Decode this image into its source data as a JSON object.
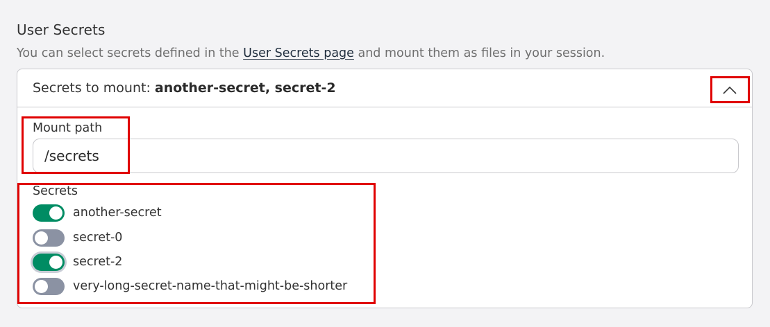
{
  "section": {
    "title": "User Secrets",
    "description_before": "You can select secrets defined in the ",
    "description_link": "User Secrets page",
    "description_after": " and mount them as files in your session."
  },
  "card": {
    "header_prefix": "Secrets to mount: ",
    "header_selected": "another-secret, secret-2",
    "collapse_icon": "chevron-up-icon"
  },
  "mount_path": {
    "label": "Mount path",
    "value": "/secrets"
  },
  "secrets": {
    "label": "Secrets",
    "items": [
      {
        "name": "another-secret",
        "enabled": true
      },
      {
        "name": "secret-0",
        "enabled": false
      },
      {
        "name": "secret-2",
        "enabled": true
      },
      {
        "name": "very-long-secret-name-that-might-be-shorter",
        "enabled": false
      }
    ]
  },
  "colors": {
    "toggle_on": "#008c63",
    "toggle_off": "#8b92a3",
    "highlight": "#e00000"
  }
}
